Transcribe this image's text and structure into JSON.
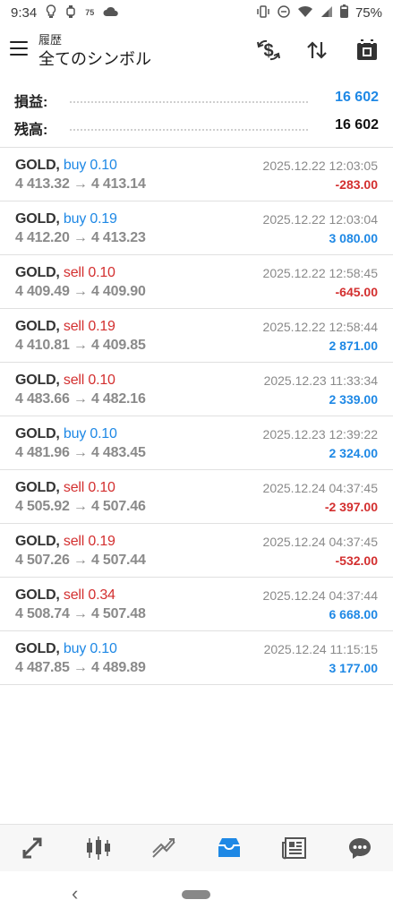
{
  "status_bar": {
    "time": "9:34",
    "extra_small": "75",
    "battery": "75%"
  },
  "header": {
    "subtitle": "履歴",
    "title": "全てのシンボル",
    "icons": [
      "currency-exchange-icon",
      "sort-icon",
      "calendar-icon"
    ]
  },
  "summary": {
    "profit_label": "損益:",
    "profit_value": "16 602",
    "balance_label": "残高:",
    "balance_value": "16 602"
  },
  "deals": [
    {
      "symbol": "GOLD,",
      "side": "buy",
      "volume": "0.10",
      "prices": "4 413.32 → 4 413.14",
      "time": "2025.12.22 12:03:05",
      "profit": "-283.00"
    },
    {
      "symbol": "GOLD,",
      "side": "buy",
      "volume": "0.19",
      "prices": "4 412.20 → 4 413.23",
      "time": "2025.12.22 12:03:04",
      "profit": "3 080.00"
    },
    {
      "symbol": "GOLD,",
      "side": "sell",
      "volume": "0.10",
      "prices": "4 409.49 → 4 409.90",
      "time": "2025.12.22 12:58:45",
      "profit": "-645.00"
    },
    {
      "symbol": "GOLD,",
      "side": "sell",
      "volume": "0.19",
      "prices": "4 410.81 → 4 409.85",
      "time": "2025.12.22 12:58:44",
      "profit": "2 871.00"
    },
    {
      "symbol": "GOLD,",
      "side": "sell",
      "volume": "0.10",
      "prices": "4 483.66 → 4 482.16",
      "time": "2025.12.23 11:33:34",
      "profit": "2 339.00"
    },
    {
      "symbol": "GOLD,",
      "side": "buy",
      "volume": "0.10",
      "prices": "4 481.96 → 4 483.45",
      "time": "2025.12.23 12:39:22",
      "profit": "2 324.00"
    },
    {
      "symbol": "GOLD,",
      "side": "sell",
      "volume": "0.10",
      "prices": "4 505.92 → 4 507.46",
      "time": "2025.12.24 04:37:45",
      "profit": "-2 397.00"
    },
    {
      "symbol": "GOLD,",
      "side": "sell",
      "volume": "0.19",
      "prices": "4 507.26 → 4 507.44",
      "time": "2025.12.24 04:37:45",
      "profit": "-532.00"
    },
    {
      "symbol": "GOLD,",
      "side": "sell",
      "volume": "0.34",
      "prices": "4 508.74 → 4 507.48",
      "time": "2025.12.24 04:37:44",
      "profit": "6 668.00"
    },
    {
      "symbol": "GOLD,",
      "side": "buy",
      "volume": "0.10",
      "prices": "4 487.85 → 4 489.89",
      "time": "2025.12.24 11:15:15",
      "profit": "3 177.00"
    }
  ],
  "bottom_nav": {
    "items": [
      "quotes-icon",
      "chart-icon",
      "trade-icon",
      "history-icon",
      "news-icon",
      "chat-icon"
    ],
    "active": "history-icon"
  },
  "colors": {
    "buy": "#1e88e5",
    "sell": "#d32f2f",
    "positive": "#1e88e5",
    "negative": "#d32f2f",
    "active_nav": "#1e88e5"
  }
}
